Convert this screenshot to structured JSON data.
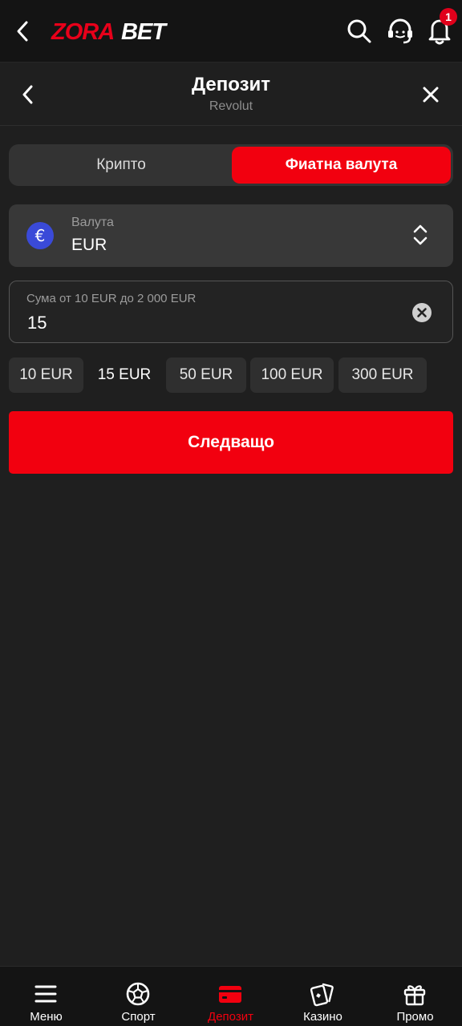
{
  "header": {
    "logo_text": "ZORABET",
    "notification_count": "1"
  },
  "subheader": {
    "title": "Депозит",
    "subtitle": "Revolut"
  },
  "tabs": [
    {
      "label": "Крипто",
      "active": false
    },
    {
      "label": "Фиатна валута",
      "active": true
    }
  ],
  "currency": {
    "label": "Валута",
    "value": "EUR",
    "icon": "euro-icon",
    "symbol": "€",
    "icon_color": "#3a4ad8"
  },
  "amount": {
    "label": "Сума от 10 EUR до 2 000 EUR",
    "value": "15"
  },
  "presets": [
    "10 EUR",
    "15 EUR",
    "50 EUR",
    "100 EUR",
    "300 EUR"
  ],
  "selected_preset": "15 EUR",
  "next_button": "Следващо",
  "bottom_nav": [
    {
      "label": "Меню",
      "icon": "menu-icon",
      "active": false
    },
    {
      "label": "Спорт",
      "icon": "soccer-ball-icon",
      "active": false
    },
    {
      "label": "Депозит",
      "icon": "card-icon",
      "active": true
    },
    {
      "label": "Казино",
      "icon": "cards-icon",
      "active": false
    },
    {
      "label": "Промо",
      "icon": "gift-icon",
      "active": false
    }
  ],
  "colors": {
    "accent": "#f2000f",
    "background": "#1f1f1f",
    "topbar": "#141414"
  }
}
